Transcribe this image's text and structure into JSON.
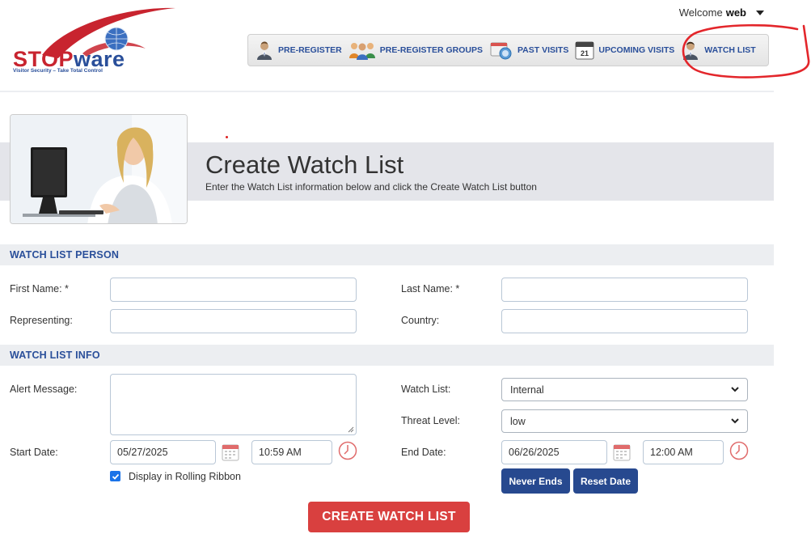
{
  "brand": {
    "name_part1": "STOP",
    "name_part2": "ware",
    "tagline": "Visitor Security – Take Total Control"
  },
  "user": {
    "welcome_prefix": "Welcome",
    "username": "web"
  },
  "nav": [
    {
      "label": "PRE-REGISTER",
      "icon": "person-icon"
    },
    {
      "label": "PRE-REGISTER GROUPS",
      "icon": "group-icon"
    },
    {
      "label": "PAST VISITS",
      "icon": "calendar-search-icon"
    },
    {
      "label": "UPCOMING VISITS",
      "icon": "calendar-21-icon",
      "icon_text": "21"
    },
    {
      "label": "WATCH LIST",
      "icon": "person-icon"
    }
  ],
  "banner": {
    "title": "Create Watch List",
    "subtitle": "Enter the Watch List information below and click the Create Watch List button"
  },
  "person": {
    "section_title": "WATCH LIST PERSON",
    "first_name_label": "First Name: *",
    "first_name_value": "",
    "last_name_label": "Last Name: *",
    "last_name_value": "",
    "representing_label": "Representing:",
    "representing_value": "",
    "country_label": "Country:",
    "country_value": ""
  },
  "info": {
    "section_title": "WATCH LIST INFO",
    "alert_label": "Alert Message:",
    "alert_value": "",
    "watch_list_label": "Watch List:",
    "watch_list_value": "Internal",
    "threat_label": "Threat Level:",
    "threat_value": "low",
    "start_label": "Start Date:",
    "start_date": "05/27/2025",
    "start_time": "10:59 AM",
    "end_label": "End Date:",
    "end_date": "06/26/2025",
    "end_time": "12:00 AM",
    "ribbon_label": "Display in Rolling Ribbon",
    "ribbon_checked": true
  },
  "buttons": {
    "never_ends": "Never Ends",
    "reset_date": "Reset Date",
    "create": "CREATE WATCH LIST"
  },
  "colors": {
    "brand_blue": "#2a4f9a",
    "brand_red": "#c8242f",
    "create_button": "#d9403f",
    "small_button": "#27498f"
  }
}
